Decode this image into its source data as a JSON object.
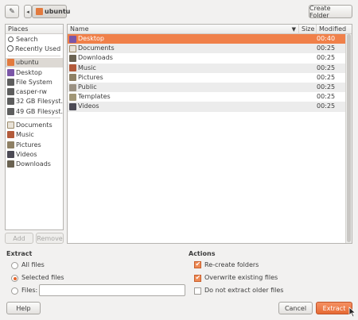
{
  "toolbar": {
    "edit_icon": "pencil-icon",
    "back_icon": "left-arrow-icon",
    "path_label": "ubuntu",
    "create_folder_label": "Create Folder"
  },
  "places": {
    "header": "Places",
    "items": [
      {
        "label": "Search",
        "icon": "search-icon"
      },
      {
        "label": "Recently Used",
        "icon": "recent-icon"
      },
      {
        "label": "ubuntu",
        "icon": "home-icon",
        "selected": true
      },
      {
        "label": "Desktop",
        "icon": "desktop-icon"
      },
      {
        "label": "File System",
        "icon": "drive-icon"
      },
      {
        "label": "casper-rw",
        "icon": "drive-icon"
      },
      {
        "label": "32 GB Filesyst...",
        "icon": "drive-icon"
      },
      {
        "label": "49 GB Filesyst...",
        "icon": "drive-icon"
      },
      {
        "label": "Documents",
        "icon": "folder-documents-icon"
      },
      {
        "label": "Music",
        "icon": "folder-music-icon"
      },
      {
        "label": "Pictures",
        "icon": "folder-pictures-icon"
      },
      {
        "label": "Videos",
        "icon": "folder-videos-icon"
      },
      {
        "label": "Downloads",
        "icon": "folder-downloads-icon"
      }
    ],
    "add_label": "Add",
    "remove_label": "Remove"
  },
  "files": {
    "columns": [
      "Name",
      "Size",
      "Modified"
    ],
    "rows": [
      {
        "name": "Desktop",
        "size": "",
        "modified": "00:40",
        "selected": true
      },
      {
        "name": "Documents",
        "size": "",
        "modified": "00:25"
      },
      {
        "name": "Downloads",
        "size": "",
        "modified": "00:25"
      },
      {
        "name": "Music",
        "size": "",
        "modified": "00:25"
      },
      {
        "name": "Pictures",
        "size": "",
        "modified": "00:25"
      },
      {
        "name": "Public",
        "size": "",
        "modified": "00:25"
      },
      {
        "name": "Templates",
        "size": "",
        "modified": "00:25"
      },
      {
        "name": "Videos",
        "size": "",
        "modified": "00:25"
      }
    ]
  },
  "extract": {
    "title": "Extract",
    "all_files": "All files",
    "selected_files": "Selected files",
    "files_label": "Files:",
    "files_value": "",
    "selected_option": "selected_files"
  },
  "actions": {
    "title": "Actions",
    "recreate_folders": "Re-create folders",
    "overwrite": "Overwrite existing files",
    "no_older": "Do not extract older files",
    "recreate_checked": true,
    "overwrite_checked": true,
    "no_older_checked": false
  },
  "buttons": {
    "help": "Help",
    "cancel": "Cancel",
    "extract": "Extract"
  },
  "colors": {
    "accent": "#f08049",
    "selection_row": "#f08049"
  }
}
